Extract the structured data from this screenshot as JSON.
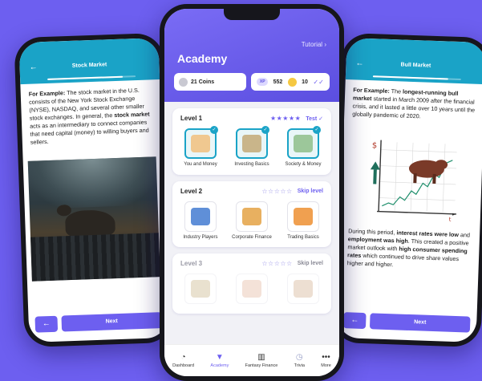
{
  "left_phone": {
    "title": "Stock Market",
    "back_icon": "arrow-left-icon",
    "progress": 0.85,
    "text_lead": "For Example:",
    "text_1": " The stock market in the U.S. consists of the New York Stock Exchange (NYSE), NASDAQ, and several other smaller stock exchanges. In general, the ",
    "text_bold": "stock market",
    "text_2": " acts as an intermediary to connect companies that need capital (money) to willing buyers and sellers.",
    "next_label": "Next"
  },
  "right_phone": {
    "title": "Bull Market",
    "progress": 0.85,
    "para1_lead": "For Example:",
    "para1_a": " The ",
    "para1_bold": "longest-running bull market",
    "para1_b": " started in March 2009 after the financial crisis, and it lasted a little over 10 years until the globally pandemic of 2020.",
    "para2_a": "During this period, ",
    "para2_bold1": "interest rates were low",
    "para2_b": " and ",
    "para2_bold2": "employment was high",
    "para2_c": ". This created a positive market outlook with ",
    "para2_bold3": "high consumer spending rates",
    "para2_d": " which continued to drive share values higher and higher.",
    "next_label": "Next"
  },
  "center_phone": {
    "tutorial": "Tutorial",
    "title": "Academy",
    "coins": "21 Coins",
    "xp_badge": "XP",
    "xp_value": "552",
    "streak_value": "10",
    "levels": [
      {
        "name": "Level 1",
        "stars": "★★★★★",
        "action": "Test",
        "modules": [
          {
            "label": "You and Money",
            "color": "#f0c890"
          },
          {
            "label": "Investing Basics",
            "color": "#c9b58a"
          },
          {
            "label": "Society & Money",
            "color": "#9cc79a"
          }
        ]
      },
      {
        "name": "Level 2",
        "stars": "☆☆☆☆☆",
        "action": "Skip level",
        "modules": [
          {
            "label": "Industry Players",
            "color": "#5f8fd8"
          },
          {
            "label": "Corporate Finance",
            "color": "#e8b060"
          },
          {
            "label": "Trading Basics",
            "color": "#f0a050"
          }
        ]
      },
      {
        "name": "Level 3",
        "stars": "☆☆☆☆☆",
        "action": "Skip level",
        "modules": [
          {
            "label": "",
            "color": "#c9b58a"
          },
          {
            "label": "",
            "color": "#e6b8a0"
          },
          {
            "label": "",
            "color": "#d4b090"
          }
        ]
      }
    ],
    "tabs": [
      {
        "label": "Dashboard",
        "icon": "dashboard-icon"
      },
      {
        "label": "Academy",
        "icon": "academy-icon"
      },
      {
        "label": "Fantasy Finance",
        "icon": "book-icon"
      },
      {
        "label": "Trivia",
        "icon": "trivia-icon"
      },
      {
        "label": "More",
        "icon": "more-icon"
      }
    ]
  }
}
